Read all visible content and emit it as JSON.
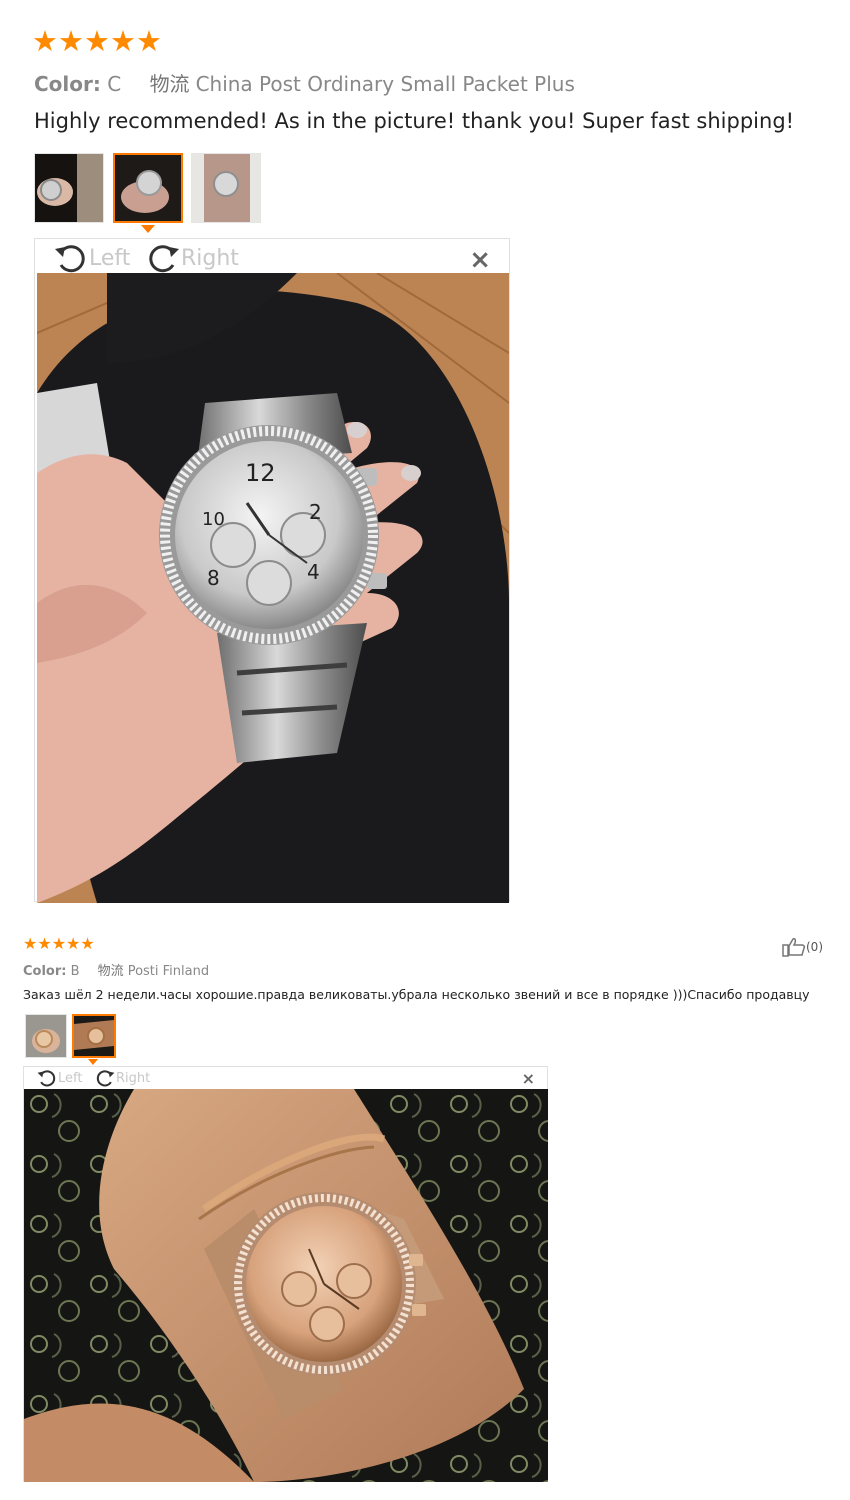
{
  "reviews": [
    {
      "stars": "★★★★★",
      "color_label": "Color:",
      "color_value": "C",
      "shipping_cn": "物流",
      "shipping": "China Post Ordinary Small Packet Plus",
      "text": "Highly recommended! As in the picture! thank you! Super fast shipping!",
      "rotate_left": "Left",
      "rotate_right": "Right",
      "close": "×"
    },
    {
      "stars": "★★★★★",
      "color_label": "Color:",
      "color_value": "B",
      "shipping_cn": "物流",
      "shipping": "Posti Finland",
      "helpful_count": "(0)",
      "text": "Заказ шёл 2 недели.часы хорошие.правда великоваты.убрала несколько звений и все в порядке )))Спасибо продавцу",
      "rotate_left": "Left",
      "rotate_right": "Right",
      "close": "×"
    }
  ],
  "watch_faces": {
    "silver_numbers": [
      "12",
      "10",
      "2",
      "8",
      "4"
    ]
  },
  "colors": {
    "star": "#ff8a00",
    "selected_border": "#ff7a00",
    "meta_text": "#888888"
  }
}
